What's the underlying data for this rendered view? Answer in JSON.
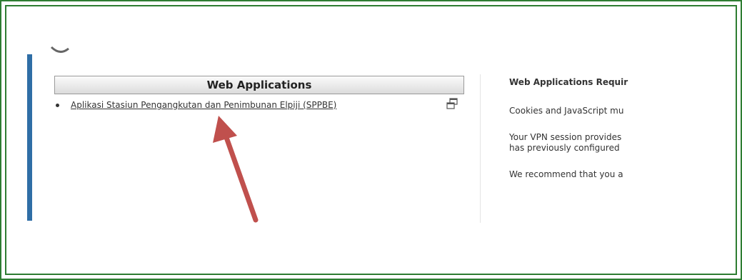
{
  "frame": {
    "color": "#2e7d32"
  },
  "accent": {
    "color": "#2f6ea6"
  },
  "web_applications": {
    "header": "Web Applications",
    "items": [
      {
        "label": "Aplikasi Stasiun Pengangkutan dan Penimbunan Elpiji (SPPBE)",
        "icon": "new-window-icon"
      }
    ]
  },
  "annotation": {
    "icon": "red-arrow",
    "color": "#c0504d"
  },
  "right_panel": {
    "title": "Web Applications Requir",
    "paragraphs": [
      [
        "Cookies and JavaScript mu"
      ],
      [
        "Your VPN session provides",
        "has previously configured"
      ],
      [
        "We recommend that you a"
      ]
    ]
  }
}
